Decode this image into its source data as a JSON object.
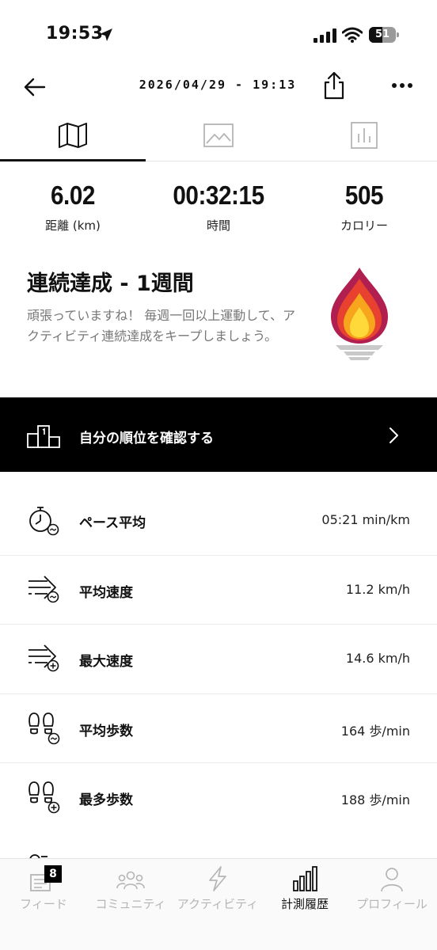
{
  "status_bar": {
    "time": "19:53",
    "battery_level": "51",
    "icons": [
      "location-arrow-icon",
      "cellular-signal-icon",
      "wifi-icon",
      "battery-icon"
    ]
  },
  "nav": {
    "title": "2026/04/29 - 19:13",
    "icons": [
      "back-arrow-icon",
      "share-icon",
      "more-dots-icon"
    ]
  },
  "tabs": [
    {
      "icon": "map-icon",
      "active": true
    },
    {
      "icon": "photo-icon",
      "active": false
    },
    {
      "icon": "chart-icon",
      "active": false
    }
  ],
  "stats": [
    {
      "value": "6.02",
      "label": "距離 (km)"
    },
    {
      "value": "00:32:15",
      "label": "時間"
    },
    {
      "value": "505",
      "label": "カロリー"
    }
  ],
  "streak": {
    "title": "連続達成 - 1週間",
    "description": "頑張っていますね！ 毎週一回以上運動して、アクティビティ連続達成をキープしましょう。",
    "icon": "flame-torch-icon"
  },
  "ranking": {
    "label": "自分の順位を確認する",
    "icon": "podium-icon"
  },
  "metrics": [
    {
      "label": "ペース平均",
      "value": "05:21 min/km",
      "icon": "stopwatch-avg-icon"
    },
    {
      "label": "平均速度",
      "value": "11.2 km/h",
      "icon": "speed-avg-icon"
    },
    {
      "label": "最大速度",
      "value": "14.6 km/h",
      "icon": "speed-max-icon"
    },
    {
      "label": "平均歩数",
      "value": "164 歩/min",
      "icon": "footsteps-avg-icon"
    },
    {
      "label": "最多歩数",
      "value": "188 歩/min",
      "icon": "footsteps-max-icon"
    }
  ],
  "bottom_nav": [
    {
      "label": "フィード",
      "icon": "feed-icon",
      "badge": "8",
      "active": false
    },
    {
      "label": "コミュニティ",
      "icon": "community-icon",
      "active": false
    },
    {
      "label": "アクティビティ",
      "icon": "lightning-icon",
      "active": false
    },
    {
      "label": "計測履歴",
      "icon": "history-bars-icon",
      "active": true
    },
    {
      "label": "プロフィール",
      "icon": "profile-icon",
      "active": false
    }
  ],
  "colors": {
    "text": "#111111",
    "muted": "#777777",
    "banner_bg": "#000000",
    "flame_outer": "#b01f4f",
    "flame_mid": "#e8412f",
    "flame_inner": "#f7a51c",
    "flame_core": "#ffd93a",
    "inactive_tab": "#b5b5b5"
  }
}
